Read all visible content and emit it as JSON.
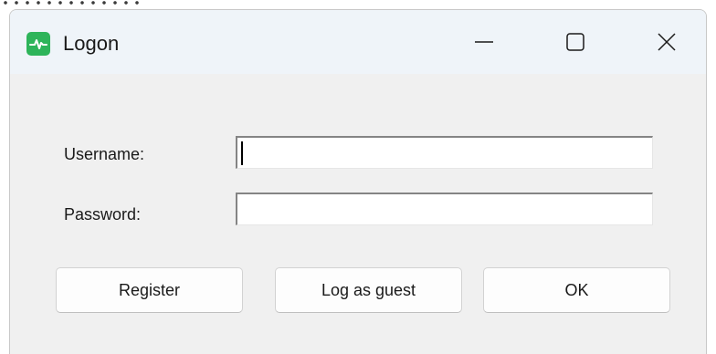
{
  "window": {
    "title": "Logon",
    "icon": "app-pulse-icon",
    "accent_color": "#2eb45a",
    "controls": [
      "minimize-icon",
      "maximize-icon",
      "close-icon"
    ]
  },
  "form": {
    "username_label": "Username:",
    "username_value": "",
    "password_label": "Password:",
    "password_value": ""
  },
  "buttons": {
    "register": "Register",
    "guest": "Log as guest",
    "ok": "OK"
  }
}
